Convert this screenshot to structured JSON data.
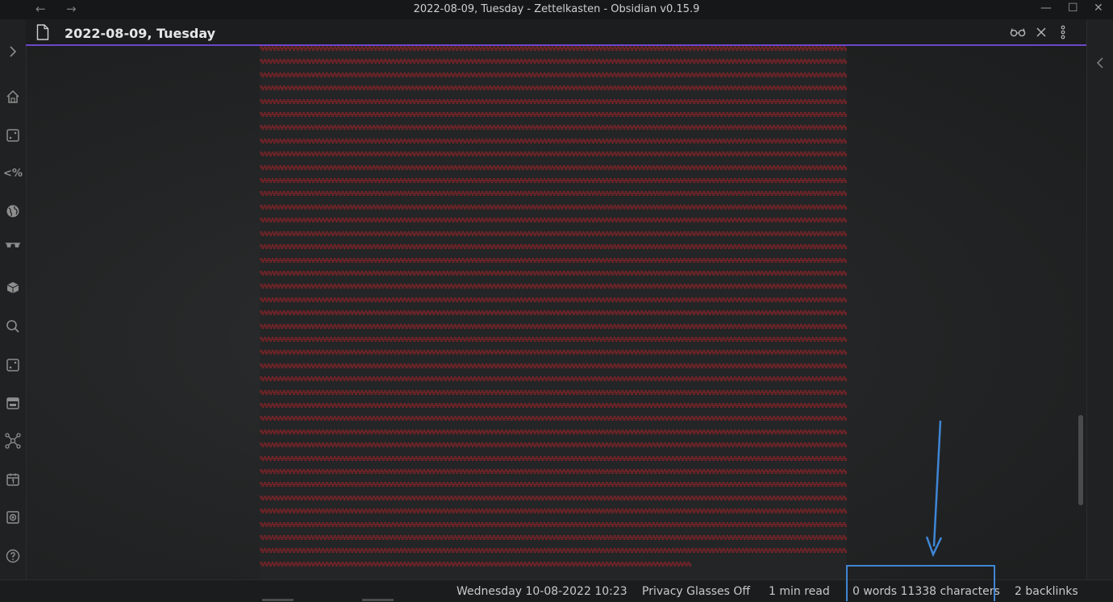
{
  "window": {
    "title": "2022-08-09, Tuesday - Zettelkasten - Obsidian v0.15.9"
  },
  "ribbon": {
    "icons": [
      "home-icon",
      "dice-icon",
      "code-percent-icon",
      "globe-icon",
      "glasses-icon",
      "cube-icon",
      "search-icon",
      "dice-icon",
      "calendar-panel-icon",
      "graph-icon",
      "calendar-icon",
      "photo-icon",
      "help-icon"
    ],
    "percent_label": "<%"
  },
  "tab": {
    "title": "2022-08-09, Tuesday"
  },
  "content": {
    "unit": "%%",
    "repeat": 3000
  },
  "statusbar": {
    "datetime": "Wednesday 10-08-2022 10:23",
    "privacy": "Privacy Glasses Off",
    "read_time": "1 min read",
    "counts": "0 words 11338 characters",
    "backlinks": "2 backlinks"
  },
  "colors": {
    "accent": "#6b47c9",
    "content_text": "#b1242a",
    "annotation": "#3f86d6"
  }
}
